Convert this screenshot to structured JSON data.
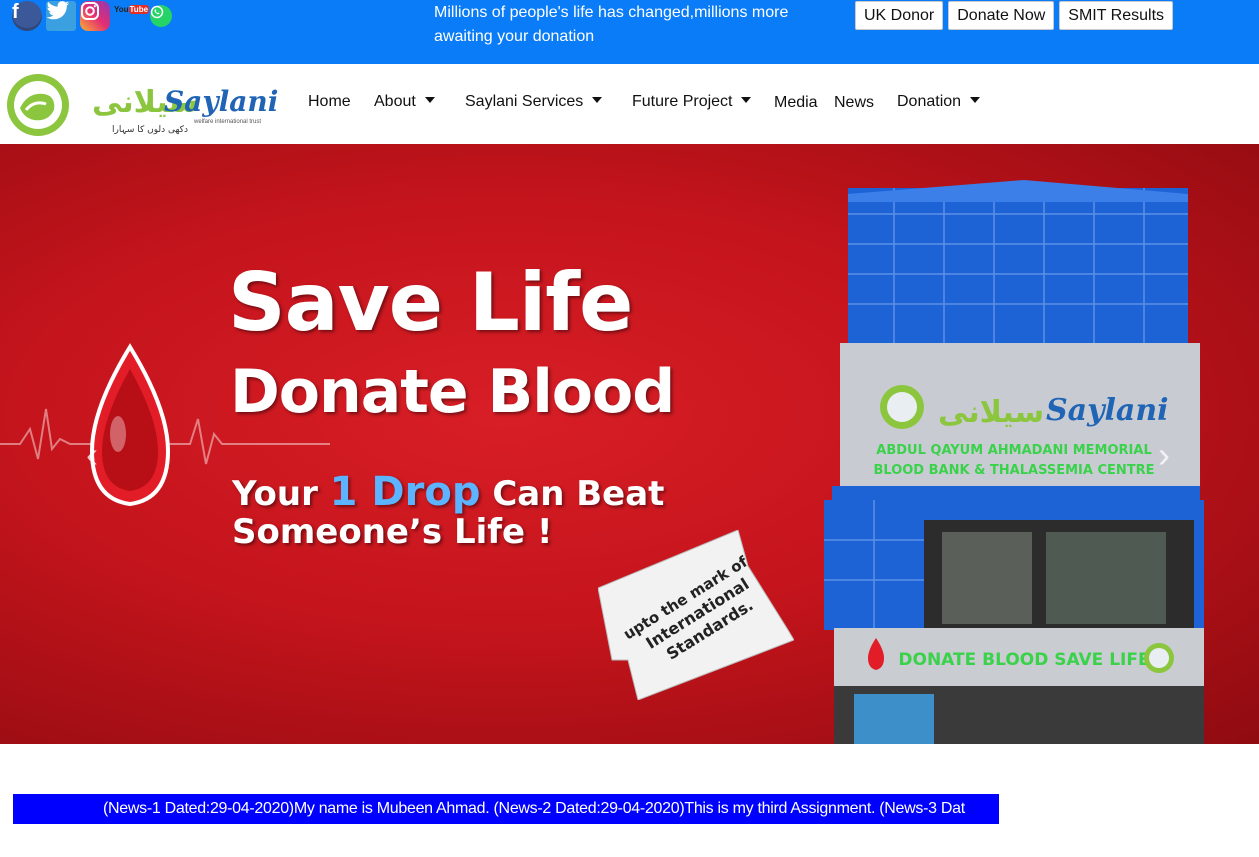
{
  "social": [
    {
      "icon": "facebook-icon",
      "label": "f"
    },
    {
      "icon": "twitter-icon",
      "label": ""
    },
    {
      "icon": "instagram-icon",
      "label": ""
    },
    {
      "icon": "youtube-icon",
      "label": "You Tube"
    },
    {
      "icon": "whatsapp-icon",
      "label": ""
    }
  ],
  "youtube": {
    "you": "You",
    "tube": "Tube"
  },
  "tagline": "Millions of people's life has changed,millions more awaiting your donation",
  "top_buttons": {
    "uk_donor": "UK Donor",
    "donate_now": "Donate Now",
    "smit_results": "SMIT Results"
  },
  "logo": {
    "brand": "Saylani",
    "urdu": "سیلانی",
    "sub": "welfare international trust",
    "motto": "دکھی دلوں کا سہارا"
  },
  "nav": {
    "home": "Home",
    "about": "About",
    "services": "Saylani Services",
    "future": "Future Project",
    "media": "Media",
    "news": "News",
    "donation": "Donation"
  },
  "carousel": {
    "prev": "‹",
    "next": "›",
    "headline1": "Save Life",
    "headline2": "Donate Blood",
    "line3_a": "Your ",
    "line3_b": "1 Drop",
    "line3_c": " Can Beat",
    "line4": "Someone’s Life !",
    "stamp": [
      "upto the mark of",
      "International",
      "Standards."
    ],
    "building_brand": "Saylani",
    "building_urdu": "سیلانی",
    "building_line1": "ABDUL QAYUM AHMADANI MEMORIAL",
    "building_line2": "BLOOD BANK & THALASSEMIA CENTRE",
    "building_banner": "DONATE BLOOD SAVE LIFE"
  },
  "ticker": "(News-1 Dated:29-04-2020)My name is Mubeen Ahmad. (News-2 Dated:29-04-2020)This is my third Assignment. (News-3 Dat",
  "colors": {
    "topbar": "#0a7cf7",
    "hero_red": "#c5141c",
    "ticker": "#0000ff",
    "logo_green": "#8cc63f",
    "logo_blue": "#1f64b5"
  }
}
